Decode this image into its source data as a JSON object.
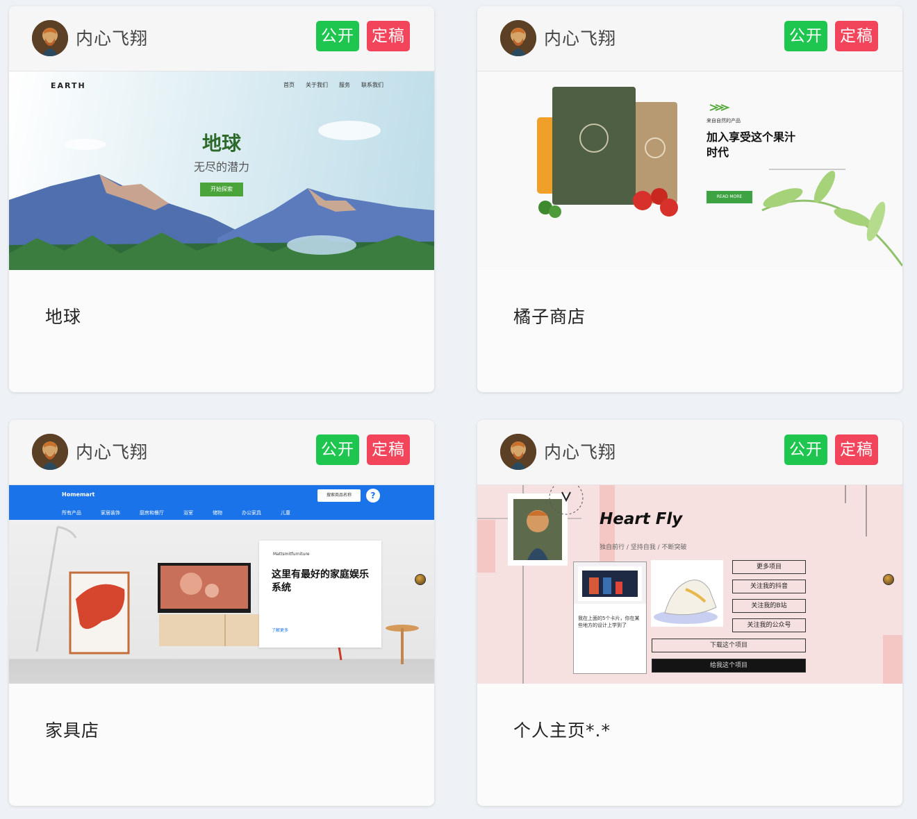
{
  "cards": [
    {
      "author": "内心飞翔",
      "public_label": "公开",
      "final_label": "定稿",
      "title": "地球",
      "preview": {
        "logo": "EARTH",
        "nav": [
          "首页",
          "关于我们",
          "服务",
          "联系我们"
        ],
        "heading": "地球",
        "subheading": "无尽的潜力",
        "button": "开始探索"
      }
    },
    {
      "author": "内心飞翔",
      "public_label": "公开",
      "final_label": "定稿",
      "title": "橘子商店",
      "preview": {
        "kicker": "来自自然的产品",
        "heading": "加入享受这个果汁时代",
        "button": "READ MORE"
      }
    },
    {
      "author": "内心飞翔",
      "public_label": "公开",
      "final_label": "定稿",
      "title": "家具店",
      "preview": {
        "brand": "Homemart",
        "search": "搜索商品名称",
        "help": "?",
        "menu": [
          "所有产品",
          "家居装饰",
          "厨房和餐厅",
          "浴室",
          "储物",
          "办公家具",
          "儿童"
        ],
        "panel_small": "Mattsmitfurniture",
        "panel_heading": "这里有最好的家庭娱乐系统",
        "panel_link": "了解更多"
      }
    },
    {
      "author": "内心飞翔",
      "public_label": "公开",
      "final_label": "定稿",
      "title": "个人主页*.*",
      "preview": {
        "heading": "Heart Fly",
        "subheading": "独自前行 / 坚持自我 / 不断突破",
        "side_buttons": [
          "更多项目",
          "关注我的抖音",
          "关注我的B站",
          "关注我的公众号"
        ],
        "wide_button": "下载这个项目",
        "dark_button": "给我这个项目",
        "card_text": "我在上面的5个卡片，你在某些地方的设计上学到了"
      }
    }
  ]
}
